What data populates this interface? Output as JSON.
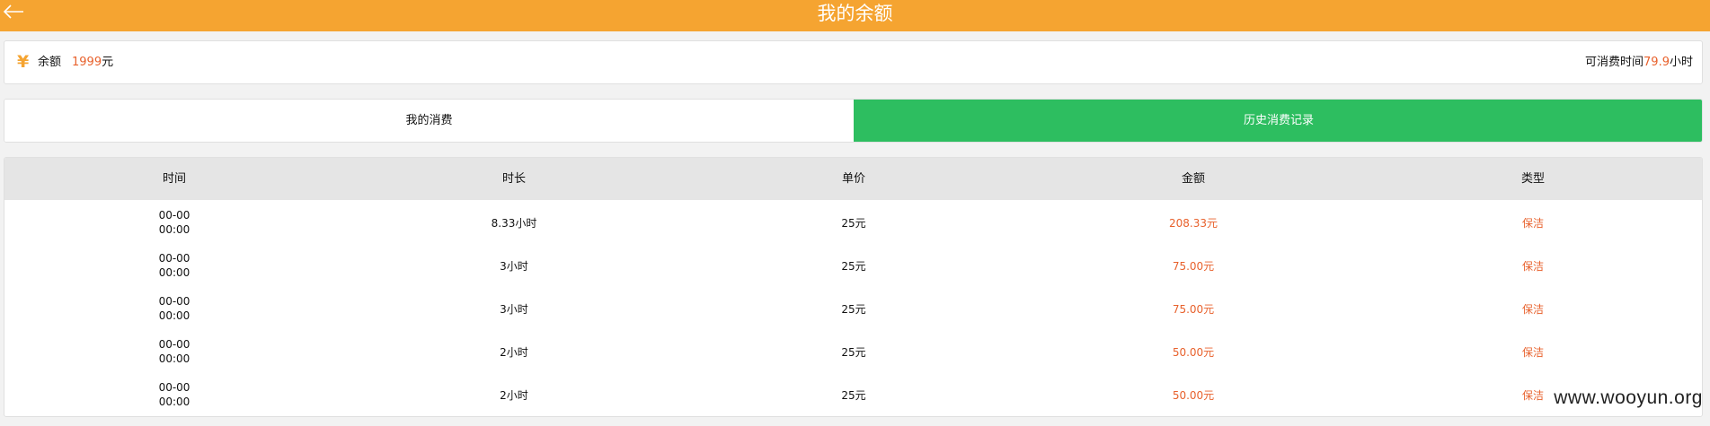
{
  "header": {
    "title": "我的余额",
    "back_icon": "arrow-left-icon"
  },
  "balance": {
    "label": "余额",
    "amount": "1999",
    "unit": "元",
    "time_label": "可消费时间",
    "time_value": "79.9",
    "time_unit": "小时"
  },
  "tabs": [
    {
      "label": "我的消费"
    },
    {
      "label": "历史消费记录"
    }
  ],
  "table": {
    "headers": [
      "时间",
      "时长",
      "单价",
      "金额",
      "类型"
    ],
    "rows": [
      {
        "date": "00-00",
        "time": "00:00",
        "duration": "8.33小时",
        "price": "25元",
        "amount": "208.33元",
        "type": "保洁"
      },
      {
        "date": "00-00",
        "time": "00:00",
        "duration": "3小时",
        "price": "25元",
        "amount": "75.00元",
        "type": "保洁"
      },
      {
        "date": "00-00",
        "time": "00:00",
        "duration": "3小时",
        "price": "25元",
        "amount": "75.00元",
        "type": "保洁"
      },
      {
        "date": "00-00",
        "time": "00:00",
        "duration": "2小时",
        "price": "25元",
        "amount": "50.00元",
        "type": "保洁"
      },
      {
        "date": "00-00",
        "time": "00:00",
        "duration": "2小时",
        "price": "25元",
        "amount": "50.00元",
        "type": "保洁"
      }
    ]
  },
  "watermark": "www.wooyun.org",
  "colors": {
    "header": "#f5a431",
    "active_tab": "#2dbe60",
    "accent": "#e8612c"
  }
}
